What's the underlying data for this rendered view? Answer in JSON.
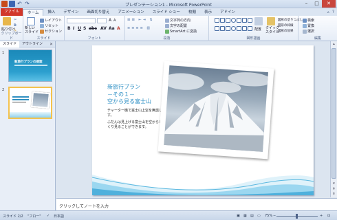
{
  "window": {
    "title": "プレゼンテーション1 - Microsoft PowerPoint",
    "minimize": "–",
    "maximize": "□",
    "close": "✕"
  },
  "tabs": [
    "ファイル",
    "ホーム",
    "挿入",
    "デザイン",
    "画面切り替え",
    "アニメーション",
    "スライド ショー",
    "校閲",
    "表示",
    "アドイン"
  ],
  "ribbon": {
    "paste": "貼り付け",
    "clipboard": "クリップボード",
    "new_slide": "新しい\nスライド",
    "layout": "レイアウト",
    "reset": "リセット",
    "section": "セクション",
    "slides_group": "スライド",
    "font_group": "フォント",
    "paragraph_group": "段落",
    "text_direction": "文字列の方向",
    "text_align": "文字の配置",
    "smartart": "SmartArt に変換",
    "drawing_group": "図形描画",
    "arrange": "配置",
    "quick_styles": "クイック\nスタイル",
    "shape_fill": "図形の塗りつぶし",
    "shape_outline": "図形の枠線",
    "shape_effects": "図形の効果",
    "find": "検索",
    "replace": "置換",
    "select": "選択",
    "editing_group": "編集"
  },
  "panes": {
    "tab_slides": "スライド",
    "tab_outline": "アウトライン",
    "thumb1_num": "1",
    "thumb2_num": "2",
    "thumb1_title": "新旅行プランの提案"
  },
  "slide": {
    "title_lines": [
      "新旅行プラン",
      "－その１－",
      "空から見る富士山"
    ],
    "body": [
      "チャーター機で富士山上空を無話します。",
      "ふだんは見上げる富士山を空からじっくり見ることができます。"
    ]
  },
  "notes": {
    "placeholder": "クリックしてノートを入力"
  },
  "status": {
    "slide_info": "スライド 2/2",
    "theme": "\"フロー\"",
    "language": "日本語",
    "zoom": "75%"
  },
  "colors": {
    "accent": "#2d8fc4",
    "file_tab": "#d1372a",
    "selected_thumb": "#f4c24d"
  }
}
